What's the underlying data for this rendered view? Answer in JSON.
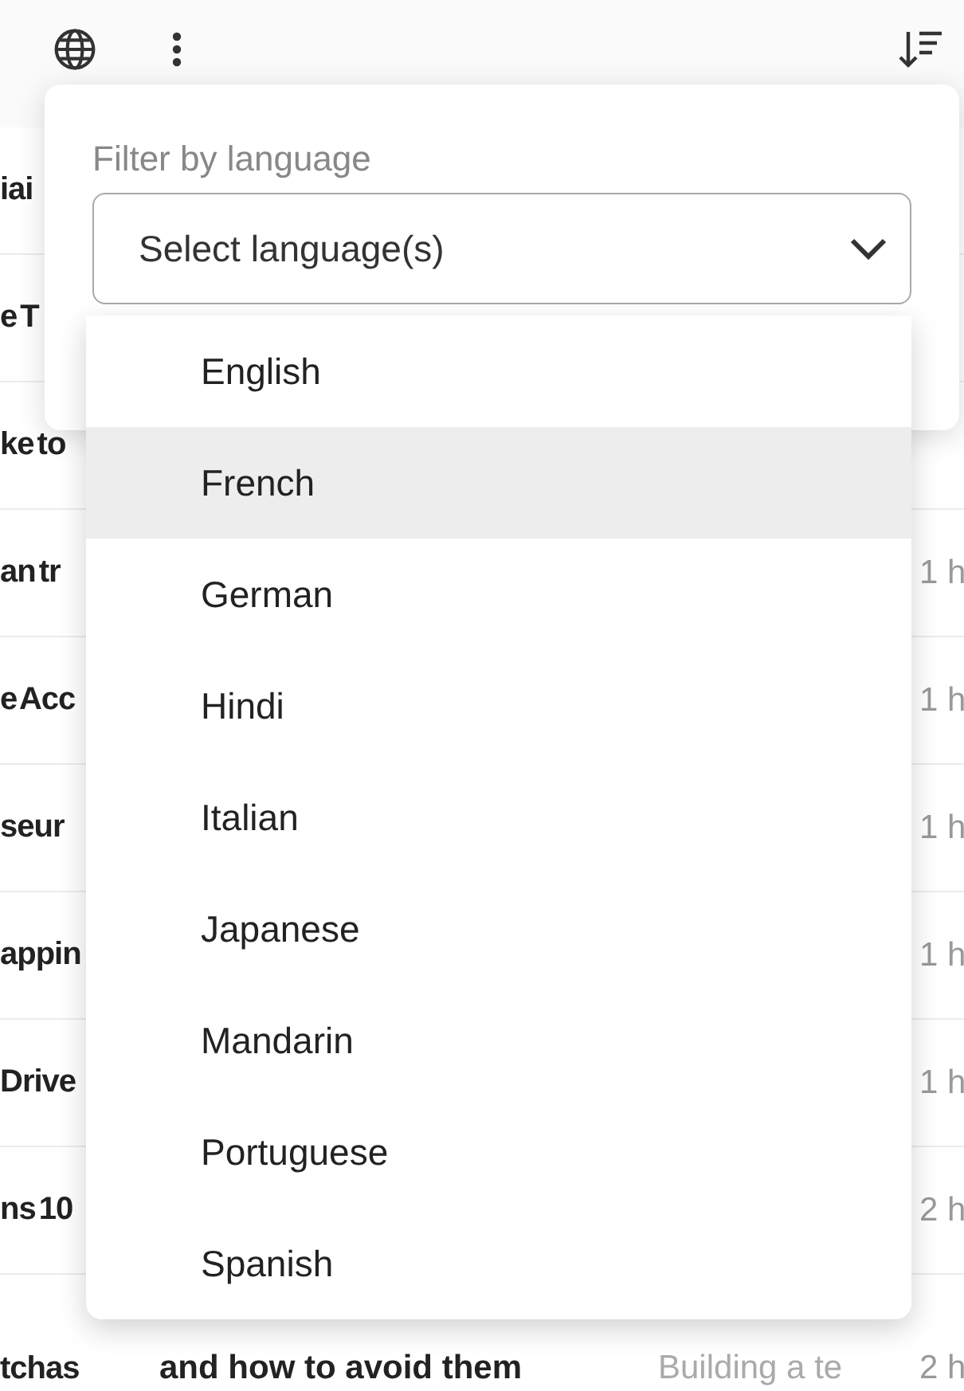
{
  "toolbar": {
    "buttons": [
      {
        "kind": "globe"
      },
      {
        "kind": "more"
      },
      {
        "kind": "sort"
      }
    ]
  },
  "rows": [
    {
      "title": "iai"
    },
    {
      "title": "e T"
    },
    {
      "title": "ke to"
    },
    {
      "title": "an tr",
      "time": "1 h"
    },
    {
      "title": "e Acc",
      "time": "1 h"
    },
    {
      "title": "seur",
      "time": "1 h"
    },
    {
      "title": "appin",
      "time": "1 h"
    },
    {
      "title": "Drive",
      "time": "1 h"
    },
    {
      "title": "ns 10",
      "time": "2 h"
    },
    {
      "title": "tchas",
      "heading": "and how to avoid them",
      "snippet": "Building a te",
      "time": "2 h"
    }
  ],
  "filter": {
    "label": "Filter by language",
    "placeholder": "Select language(s)",
    "options": [
      {
        "label": "English",
        "selected": false
      },
      {
        "label": "French",
        "selected": true
      },
      {
        "label": "German",
        "selected": false
      },
      {
        "label": "Hindi",
        "selected": false
      },
      {
        "label": "Italian",
        "selected": false
      },
      {
        "label": "Japanese",
        "selected": false
      },
      {
        "label": "Mandarin",
        "selected": false
      },
      {
        "label": "Portuguese",
        "selected": false
      },
      {
        "label": "Spanish",
        "selected": false
      }
    ]
  }
}
